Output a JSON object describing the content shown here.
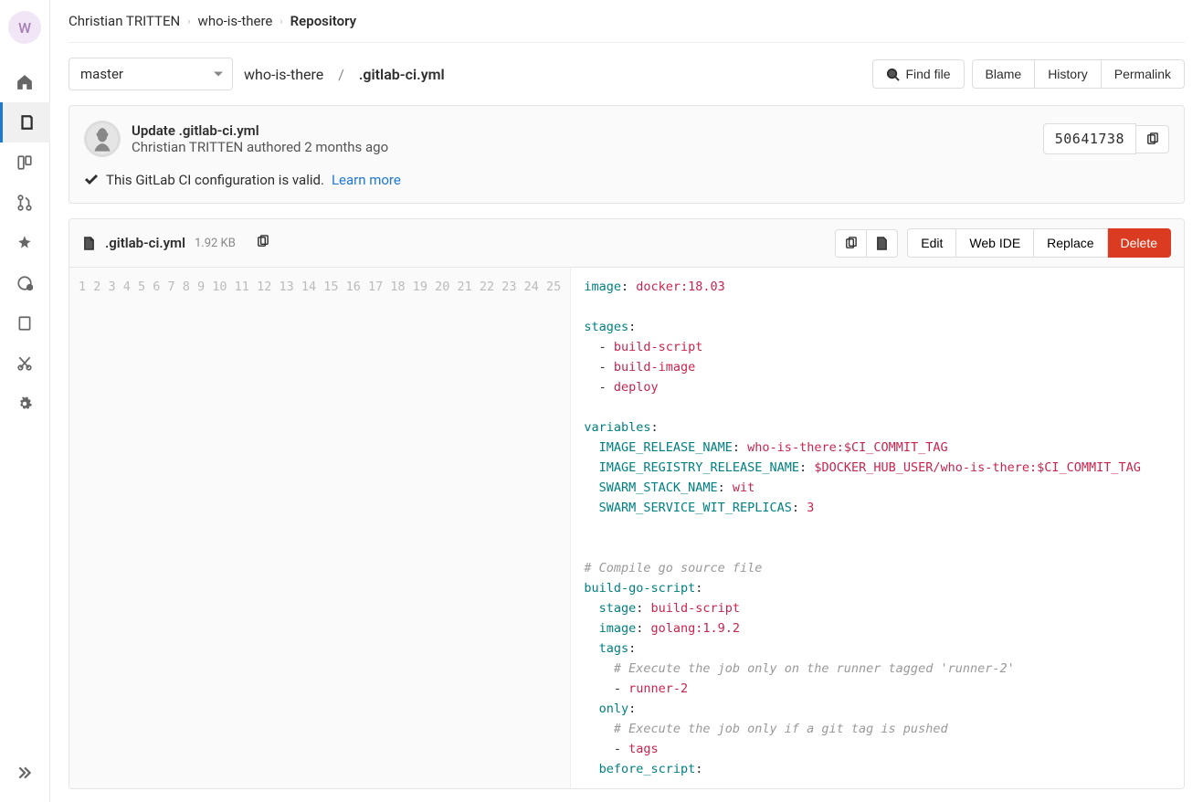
{
  "avatar_letter": "W",
  "breadcrumbs": {
    "user": "Christian TRITTEN",
    "project": "who-is-there",
    "current": "Repository"
  },
  "branch": "master",
  "path": {
    "dir": "who-is-there",
    "file": ".gitlab-ci.yml"
  },
  "buttons": {
    "find": "Find file",
    "blame": "Blame",
    "history": "History",
    "permalink": "Permalink",
    "edit": "Edit",
    "webide": "Web IDE",
    "replace": "Replace",
    "delete": "Delete"
  },
  "commit": {
    "title": "Update .gitlab-ci.yml",
    "author": "Christian TRITTEN",
    "verb": "authored",
    "time": "2 months ago",
    "sha": "50641738"
  },
  "ci_status": {
    "text": "This GitLab CI configuration is valid.",
    "learn_more": "Learn more"
  },
  "file": {
    "name": ".gitlab-ci.yml",
    "size": "1.92 KB"
  },
  "code": [
    {
      "n": 1,
      "h": "<span class='k'>image</span><span class='p'>:</span> <span class='s'>docker:18.03</span>"
    },
    {
      "n": 2,
      "h": ""
    },
    {
      "n": 3,
      "h": "<span class='k'>stages</span><span class='p'>:</span>"
    },
    {
      "n": 4,
      "h": "  <span class='p'>-</span> <span class='s'>build-script</span>"
    },
    {
      "n": 5,
      "h": "  <span class='p'>-</span> <span class='s'>build-image</span>"
    },
    {
      "n": 6,
      "h": "  <span class='p'>-</span> <span class='s'>deploy</span>"
    },
    {
      "n": 7,
      "h": ""
    },
    {
      "n": 8,
      "h": "<span class='k'>variables</span><span class='p'>:</span>"
    },
    {
      "n": 9,
      "h": "  <span class='k'>IMAGE_RELEASE_NAME</span><span class='p'>:</span> <span class='s'>who-is-there:$CI_COMMIT_TAG</span>"
    },
    {
      "n": 10,
      "h": "  <span class='k'>IMAGE_REGISTRY_RELEASE_NAME</span><span class='p'>:</span> <span class='s'>$DOCKER_HUB_USER/who-is-there:$CI_COMMIT_TAG</span>"
    },
    {
      "n": 11,
      "h": "  <span class='k'>SWARM_STACK_NAME</span><span class='p'>:</span> <span class='s'>wit</span>"
    },
    {
      "n": 12,
      "h": "  <span class='k'>SWARM_SERVICE_WIT_REPLICAS</span><span class='p'>:</span> <span class='s'>3</span>"
    },
    {
      "n": 13,
      "h": ""
    },
    {
      "n": 14,
      "h": ""
    },
    {
      "n": 15,
      "h": "<span class='c'># Compile go source file</span>"
    },
    {
      "n": 16,
      "h": "<span class='k'>build-go-script</span><span class='p'>:</span>"
    },
    {
      "n": 17,
      "h": "  <span class='k'>stage</span><span class='p'>:</span> <span class='s'>build-script</span>"
    },
    {
      "n": 18,
      "h": "  <span class='k'>image</span><span class='p'>:</span> <span class='s'>golang:1.9.2</span>"
    },
    {
      "n": 19,
      "h": "  <span class='k'>tags</span><span class='p'>:</span>"
    },
    {
      "n": 20,
      "h": "    <span class='c'># Execute the job only on the runner tagged 'runner-2'</span>"
    },
    {
      "n": 21,
      "h": "    <span class='p'>-</span> <span class='s'>runner-2</span>"
    },
    {
      "n": 22,
      "h": "  <span class='k'>only</span><span class='p'>:</span>"
    },
    {
      "n": 23,
      "h": "    <span class='c'># Execute the job only if a git tag is pushed</span>"
    },
    {
      "n": 24,
      "h": "    <span class='p'>-</span> <span class='s'>tags</span>"
    },
    {
      "n": 25,
      "h": "  <span class='k'>before_script</span><span class='p'>:</span>"
    }
  ]
}
